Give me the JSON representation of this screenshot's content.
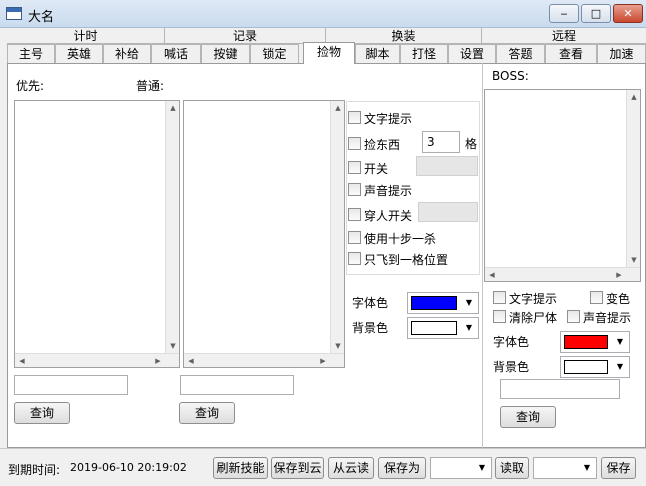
{
  "window": {
    "title": "大名",
    "minimize": "‒",
    "maximize": "□",
    "close": "✕"
  },
  "categories": [
    "计时",
    "记录",
    "换装",
    "远程"
  ],
  "tabs": [
    "主号",
    "英雄",
    "补给",
    "喊话",
    "按键",
    "锁定",
    "捡物",
    "脚本",
    "打怪",
    "设置",
    "答题",
    "查看",
    "加速"
  ],
  "left": {
    "priority_label": "优先:",
    "normal_label": "普通:",
    "query1": "查询",
    "query2": "查询"
  },
  "options": {
    "text_hint": "文字提示",
    "pick": "捡东西",
    "pick_value": "3",
    "grid_unit": "格",
    "switch": "开关",
    "sound_hint": "声音提示",
    "wear_switch": "穿人开关",
    "use_tenstep": "使用十步一杀",
    "fly_only": "只飞到一格位置"
  },
  "colors_mid": {
    "font_label": "字体色",
    "bg_label": "背景色",
    "font_color": "#0000ff",
    "bg_color": "#ffffff"
  },
  "boss": {
    "label": "BOSS:",
    "text_hint": "文字提示",
    "change_color": "变色",
    "clear_corpse": "清除尸体",
    "sound_hint": "声音提示",
    "font_label": "字体色",
    "bg_label": "背景色",
    "font_color": "#ff0000",
    "bg_color": "#ffffff",
    "query": "查询"
  },
  "bottom": {
    "expire_label": "到期时间:",
    "expire_value": "2019-06-10 20:19:02",
    "refresh": "刷新技能",
    "save_cloud": "保存到云",
    "read_cloud": "从云读",
    "save_as": "保存为",
    "read": "读取",
    "save": "保存"
  }
}
